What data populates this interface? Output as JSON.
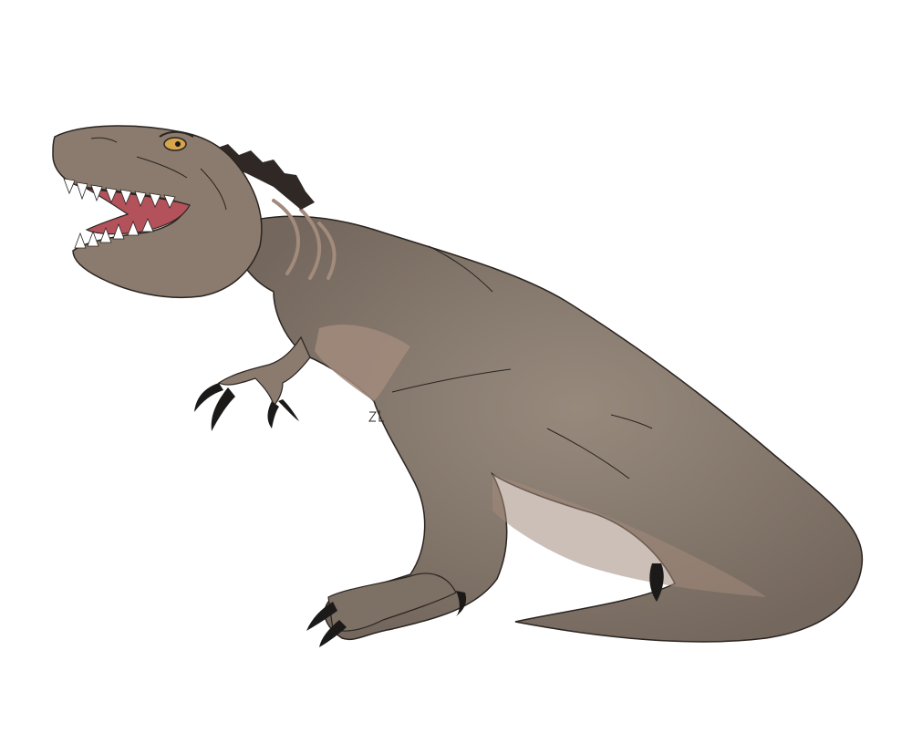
{
  "subject": "tyrannosaurus-rex-illustration",
  "colors": {
    "background": "#ffffff",
    "body": "#8a7b6e",
    "body_shadow": "#6f6258",
    "belly": "#a28b7c",
    "outline": "#2a2420",
    "mouth": "#b4525b",
    "eye": "#d7a54b",
    "claw": "#1c1a19"
  },
  "signature": "ZL"
}
